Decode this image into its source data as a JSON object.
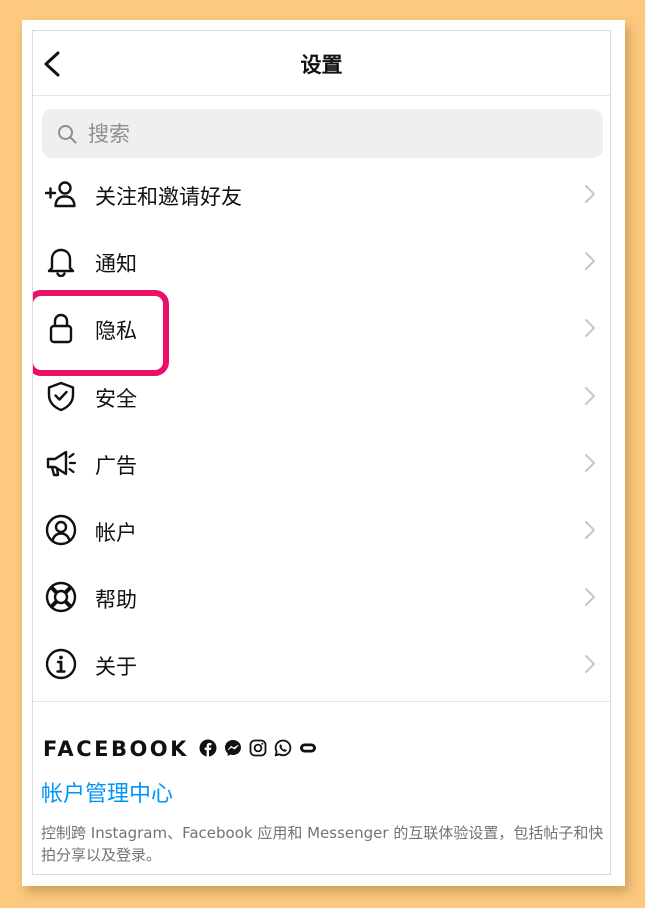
{
  "header": {
    "title": "设置"
  },
  "search": {
    "placeholder": "搜索"
  },
  "menu": {
    "items": [
      {
        "label": "关注和邀请好友",
        "icon": "add-person-icon"
      },
      {
        "label": "通知",
        "icon": "bell-icon"
      },
      {
        "label": "隐私",
        "icon": "lock-icon"
      },
      {
        "label": "安全",
        "icon": "shield-check-icon"
      },
      {
        "label": "广告",
        "icon": "megaphone-icon"
      },
      {
        "label": "帐户",
        "icon": "account-circle-icon"
      },
      {
        "label": "帮助",
        "icon": "lifebuoy-icon"
      },
      {
        "label": "关于",
        "icon": "info-icon"
      }
    ]
  },
  "footer": {
    "brand": "FACEBOOK",
    "brand_icons": [
      "facebook-icon",
      "messenger-icon",
      "instagram-icon",
      "whatsapp-icon",
      "portal-icon"
    ],
    "link": "帐户管理中心",
    "description": "控制跨 Instagram、Facebook 应用和 Messenger 的互联体验设置，包括帖子和快拍分享以及登录。"
  },
  "colors": {
    "highlight": "#ea0f6b",
    "link": "#0095f6",
    "background": "#fcc97f"
  }
}
